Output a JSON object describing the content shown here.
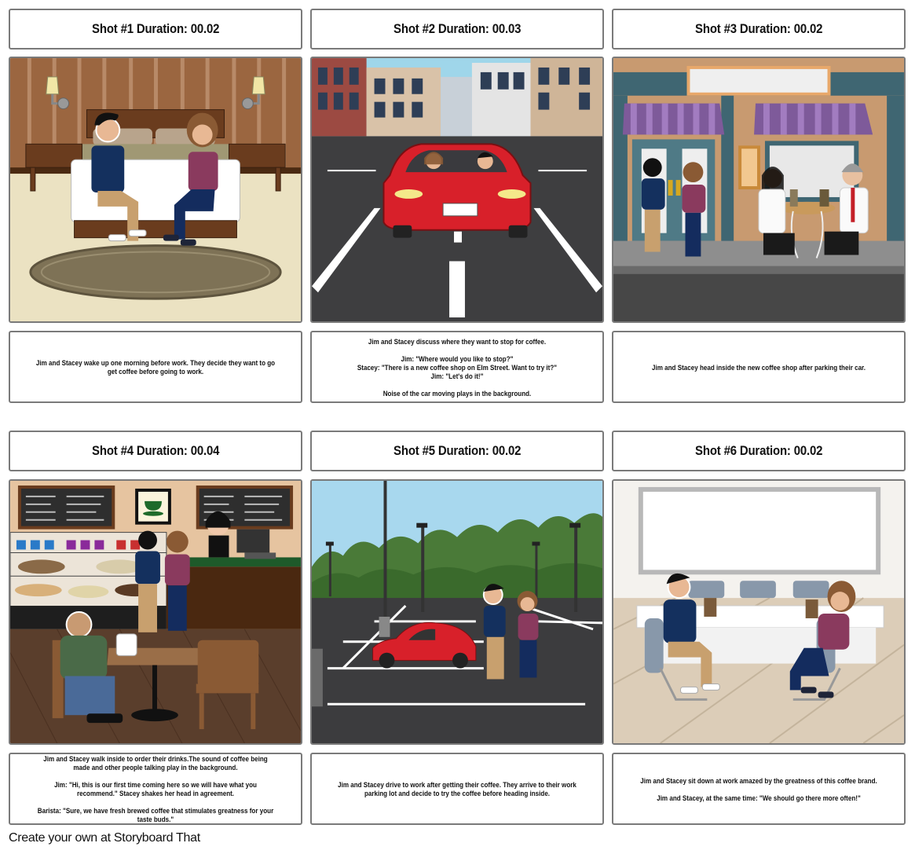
{
  "storyboard": {
    "shots": [
      {
        "title": "Shot #1 Duration: 00.02",
        "scene": "bedroom",
        "caption": "Jim and Stacey wake up one morning before work. They decide they want to go get coffee before going to work."
      },
      {
        "title": "Shot #2 Duration: 00.03",
        "scene": "city-street-car",
        "caption": "Jim and Stacey discuss where they want to stop for coffee.\n\nJim: \"Where would you like to stop?\"\nStacey: \"There is a new coffee shop on Elm Street. Want to try it?\"\nJim: \"Let's do it!\"\n\nNoise of the car moving plays in the background."
      },
      {
        "title": "Shot #3 Duration: 00.02",
        "scene": "coffee-shop-exterior",
        "caption": "Jim and Stacey head inside the new coffee shop after parking their car."
      },
      {
        "title": "Shot #4 Duration: 00.04",
        "scene": "coffee-shop-interior",
        "caption": "Jim and Stacey walk inside to order their drinks.The sound of coffee being made and other people talking play in the background.\n\nJim: \"Hi, this is our first time coming here so we will have what you recommend.\" Stacey shakes her head in agreement.\n\nBarista: \"Sure, we have fresh brewed coffee that stimulates greatness for your taste buds.\""
      },
      {
        "title": "Shot #5 Duration: 00.02",
        "scene": "parking-lot",
        "caption": "Jim and Stacey drive to work after getting their coffee. They arrive to their work parking lot and decide to try the coffee before heading inside."
      },
      {
        "title": "Shot #6 Duration: 00.02",
        "scene": "office-meeting-room",
        "caption": "Jim and Stacey sit down at work amazed by the greatness of this coffee brand.\n\nJim and Stacey, at the same time: \"We should go there more often!\""
      }
    ]
  },
  "footer": {
    "text": "Create your own at Storyboard That"
  },
  "colors": {
    "border": "#7a7a7a",
    "jim_shirt": "#14305e",
    "jim_pants": "#c8a06e",
    "stacey_top": "#8a3a5e",
    "stacey_pants": "#142c5e",
    "car_red": "#d8202a",
    "awning_purple": "#7e5a9a"
  }
}
